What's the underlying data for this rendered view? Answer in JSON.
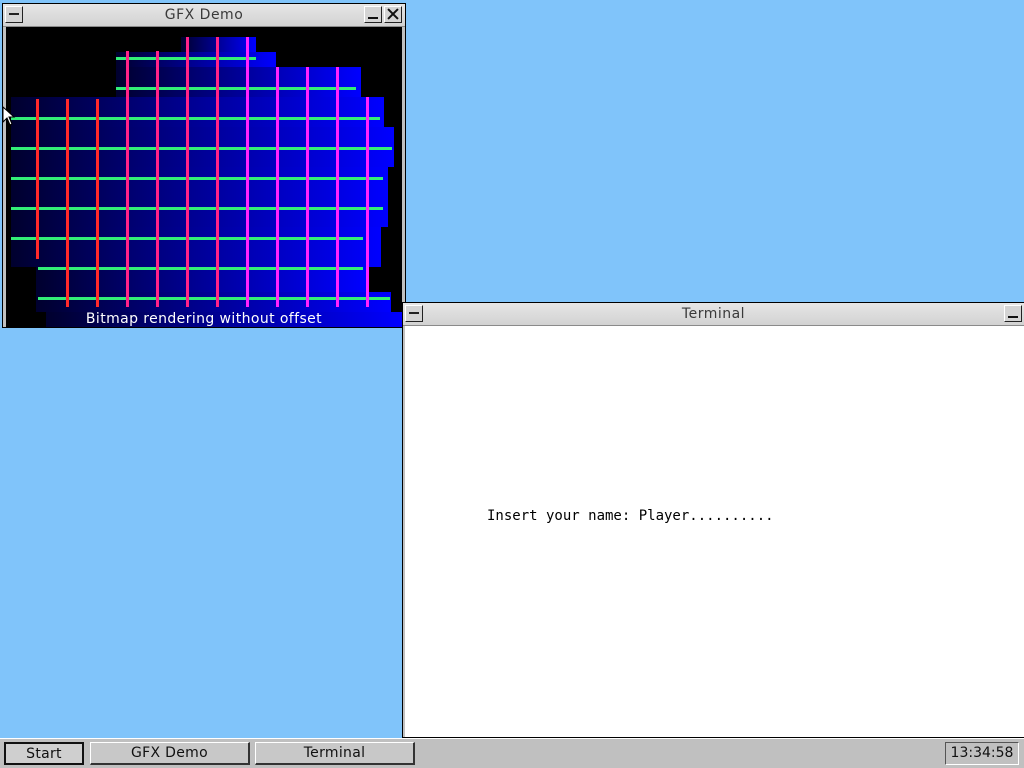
{
  "desktop": {
    "background": "#80c4fa"
  },
  "gfx_window": {
    "title": "GFX Demo",
    "caption": "Bitmap rendering without offset",
    "colors": {
      "background": "#000000",
      "gradient_left": "#00002e",
      "gradient_right": "#0000ff",
      "horizontal_lines": "#33ee77",
      "vertical_lines_left": "#ff2a2a",
      "vertical_lines_right": "#ff22ff"
    }
  },
  "terminal_window": {
    "title": "Terminal",
    "prompt_text": "Insert your name: Player.........."
  },
  "taskbar": {
    "start_label": "Start",
    "tasks": [
      "GFX Demo",
      "Terminal"
    ],
    "clock": "13:34:58"
  },
  "icons": [
    "system-menu-icon",
    "minimize-icon",
    "close-icon",
    "mouse-cursor-icon"
  ]
}
